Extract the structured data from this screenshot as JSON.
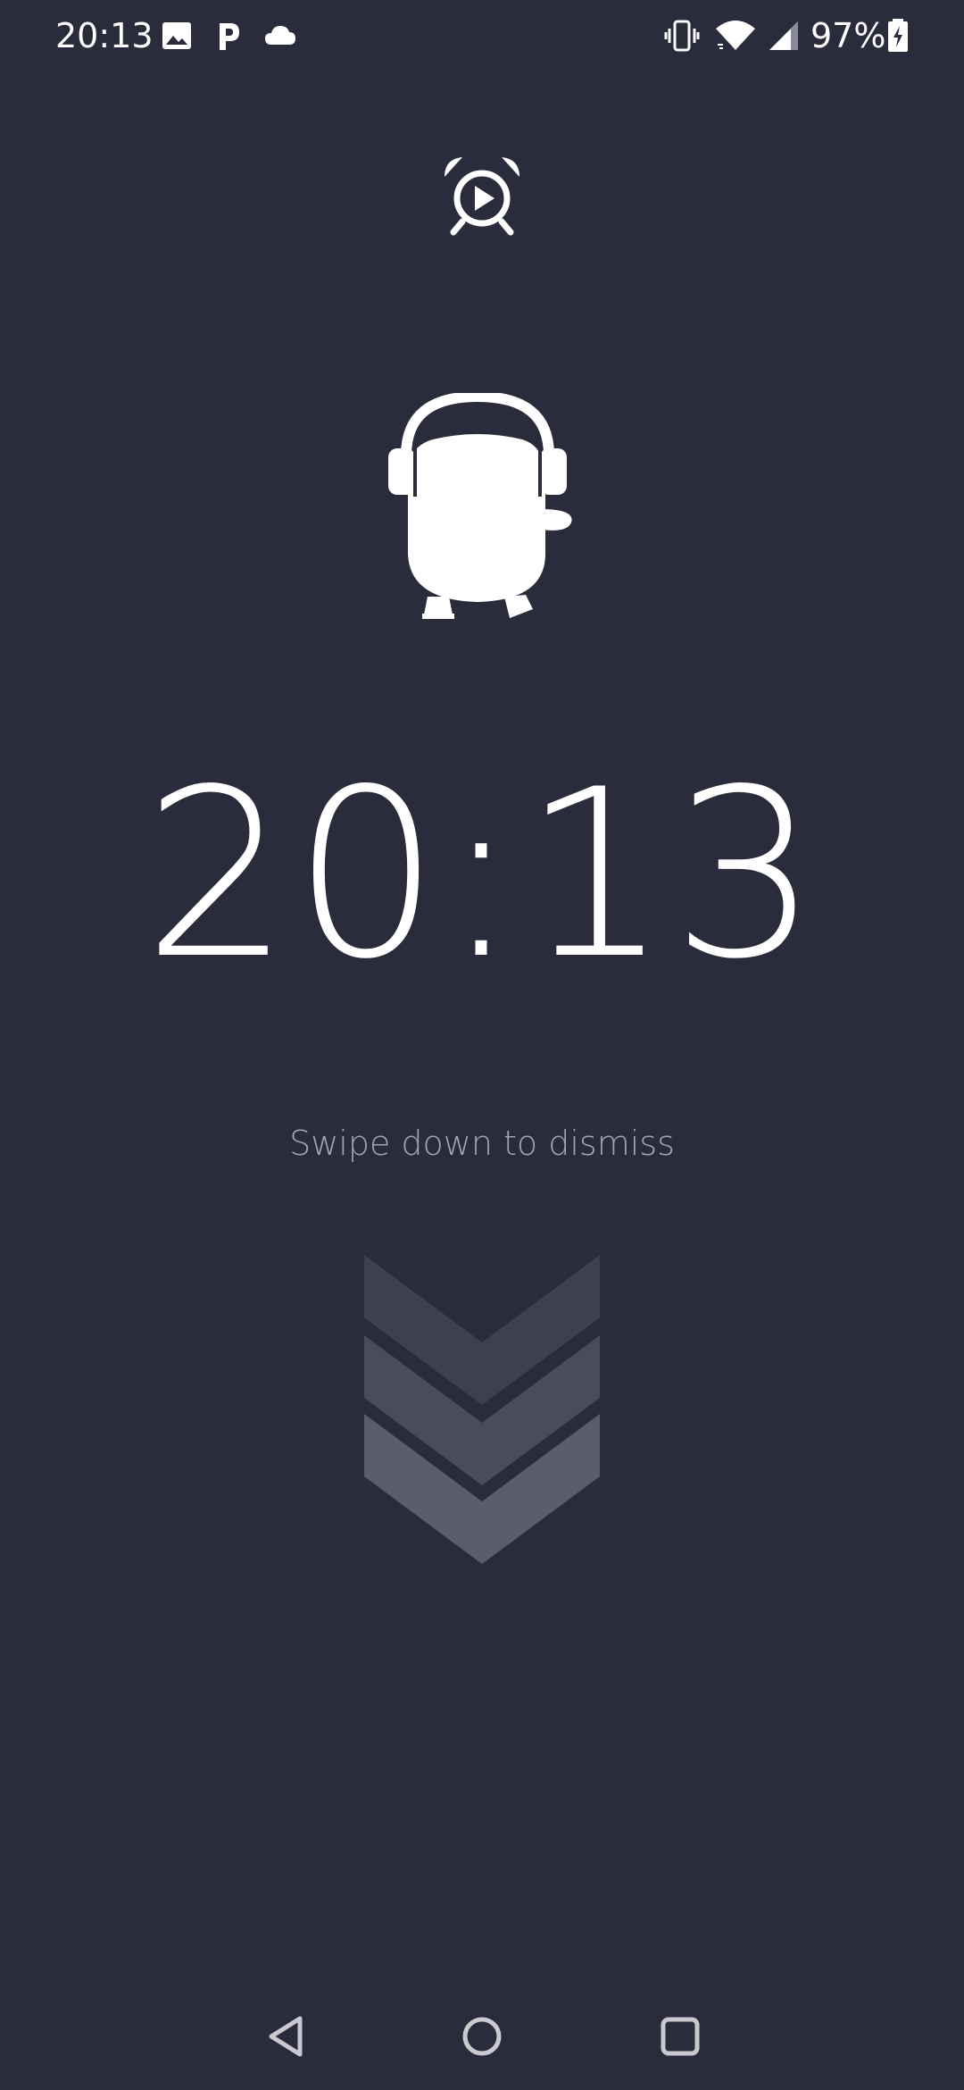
{
  "status_bar": {
    "time": "20:13",
    "notification_icons": [
      "image-icon",
      "p-app-icon",
      "cloud-icon"
    ],
    "system_icons": [
      "vibrate-icon",
      "wifi-icon",
      "cellular-signal-icon",
      "battery-charging-icon"
    ],
    "battery_percent": "97%"
  },
  "alarm": {
    "icon": "alarm-clock-play-icon",
    "mascot": "mascot-with-headphones",
    "time": "20:13",
    "dismiss_hint": "Swipe down to dismiss",
    "swipe_control": "triple-chevron-down-icon"
  },
  "nav_bar": {
    "buttons": [
      "back-icon",
      "home-icon",
      "recents-icon"
    ]
  },
  "colors": {
    "background": "#2a2b3b",
    "text_primary": "#ffffff",
    "text_secondary": "#a3a5b3",
    "chevron_top": "#3f404f",
    "chevron_middle": "#4b4c5b",
    "chevron_bottom": "#5c5d6b"
  }
}
